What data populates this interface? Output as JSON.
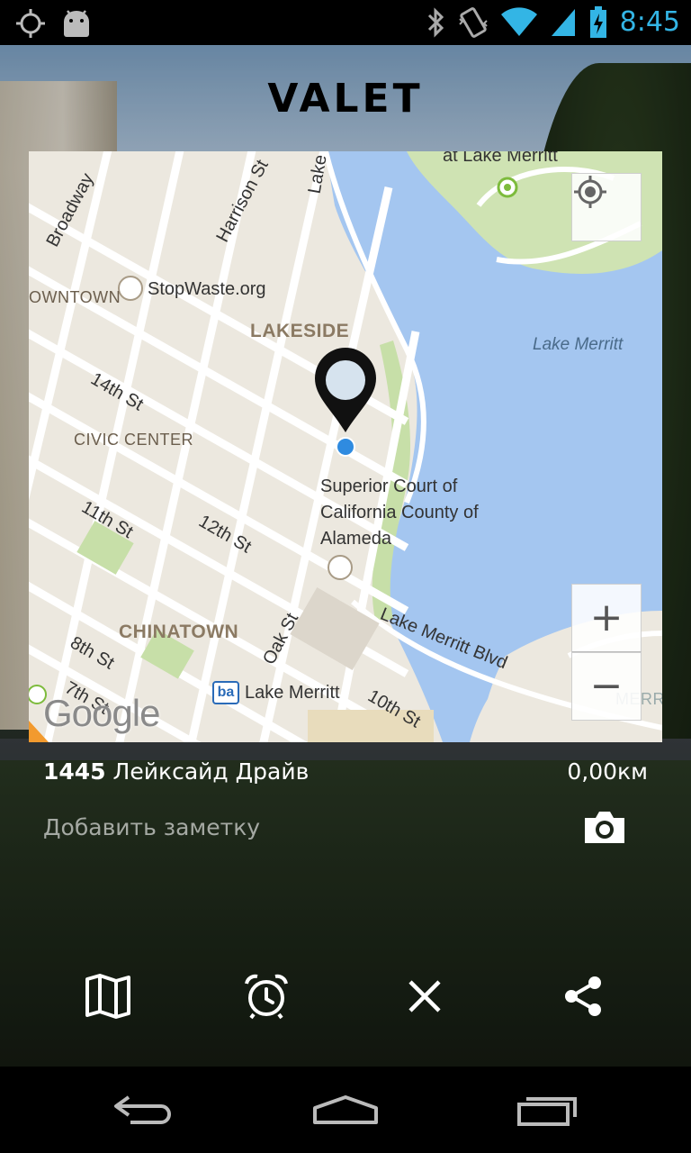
{
  "status_bar": {
    "time": "8:45",
    "icons": [
      "gps-icon",
      "android-debug-icon",
      "bluetooth-icon",
      "vibrate-icon",
      "wifi-icon",
      "signal-icon",
      "battery-charging-icon"
    ]
  },
  "app": {
    "title": "VALET"
  },
  "map": {
    "labels": {
      "broadway": "Broadway",
      "harrison_st": "Harrison St",
      "lake": "Lake",
      "at_lake_merritt": "at Lake Merritt",
      "downtown": "OWNTOWN",
      "stopwaste": "StopWaste.org",
      "lakeside": "LAKESIDE",
      "lake_merritt_water": "Lake Merritt",
      "fourteenth_st": "14th St",
      "civic_center": "CIVIC CENTER",
      "superior_court": "Superior Court of California County of Alameda",
      "eleventh_st": "11th St",
      "twelfth_st": "12th St",
      "chinatown": "CHINATOWN",
      "oak_st": "Oak St",
      "lake_merritt_blvd": "Lake Merritt Blvd",
      "eighth_st": "8th St",
      "seventh_st": "7th St",
      "bart_lake_merritt": "Lake Merritt",
      "tenth_st": "10th St",
      "merr": "MERR",
      "google": "Google",
      "bart_logo": "ba"
    },
    "controls": {
      "locate": "my-location-icon",
      "zoom_in": "+",
      "zoom_out": "−"
    }
  },
  "info": {
    "address_number": "1445",
    "address_street": "Лейксайд Драйв",
    "distance": "0,00км",
    "note_placeholder": "Добавить заметку"
  },
  "actions": [
    "map-icon",
    "alarm-icon",
    "close-icon",
    "share-icon"
  ],
  "nav": [
    "back-icon",
    "home-icon",
    "recent-apps-icon"
  ]
}
